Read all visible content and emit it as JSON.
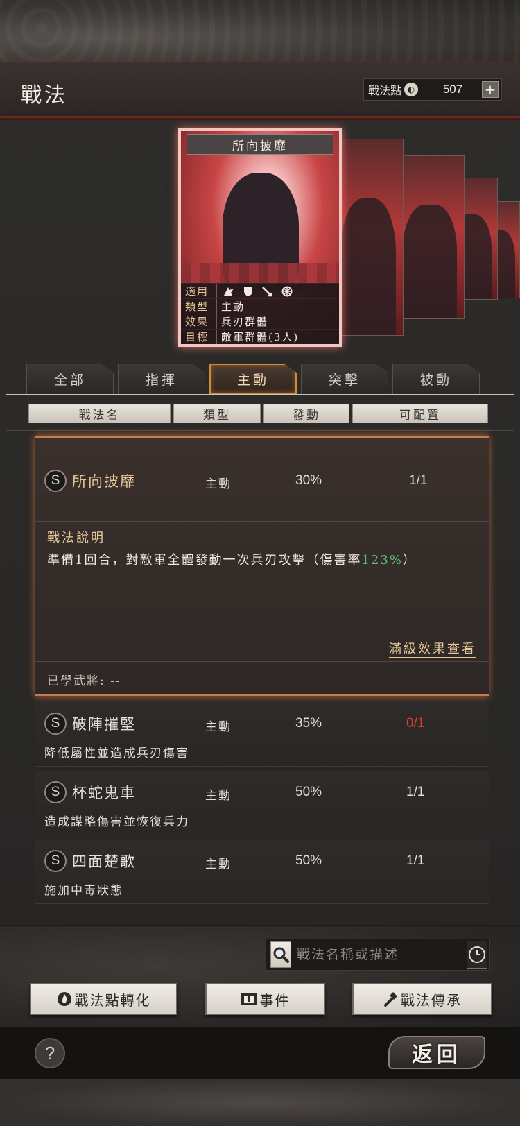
{
  "header": {
    "title": "戰法",
    "points_label": "戰法點",
    "points_icon": "coin-icon",
    "points_value": "507",
    "add_icon": "plus-icon"
  },
  "featured_card": {
    "title": "所向披靡",
    "info": [
      {
        "key": "適用",
        "value": "",
        "icons": [
          "cavalry-icon",
          "shield-icon",
          "archer-icon",
          "wheel-icon"
        ]
      },
      {
        "key": "類型",
        "value": "主動"
      },
      {
        "key": "效果",
        "value": "兵刃群體"
      },
      {
        "key": "目標",
        "value": "敵軍群體(3人)"
      }
    ]
  },
  "tabs": [
    {
      "label": "全部",
      "active": false
    },
    {
      "label": "指揮",
      "active": false
    },
    {
      "label": "主動",
      "active": true
    },
    {
      "label": "突擊",
      "active": false
    },
    {
      "label": "被動",
      "active": false
    }
  ],
  "columns": [
    "戰法名",
    "類型",
    "發動",
    "可配置"
  ],
  "expanded_item": {
    "badge": "S",
    "name": "所向披靡",
    "type": "主動",
    "rate": "30%",
    "config": "1/1",
    "desc_title": "戰法說明",
    "desc_prefix": "準備1回合，對敵軍全體發動一次兵刃攻擊（傷害率",
    "desc_highlight": "123%",
    "desc_suffix": "）",
    "full_effect_link": "滿級效果查看",
    "learned_label": "已學武將: --"
  },
  "items": [
    {
      "badge": "S",
      "name": "破陣摧堅",
      "type": "主動",
      "rate": "35%",
      "config": "0/1",
      "config_color": "#e03a2e",
      "desc": "降低屬性並造成兵刃傷害"
    },
    {
      "badge": "S",
      "name": "杯蛇鬼車",
      "type": "主動",
      "rate": "50%",
      "config": "1/1",
      "desc": "造成謀略傷害並恢復兵力"
    },
    {
      "badge": "S",
      "name": "四面楚歌",
      "type": "主動",
      "rate": "50%",
      "config": "1/1",
      "desc": "施加中毒狀態"
    }
  ],
  "search": {
    "placeholder": "戰法名稱或描述",
    "search_icon": "magnifier-icon",
    "history_icon": "clock-icon"
  },
  "buttons": {
    "convert": "戰法點轉化",
    "convert_icon": "flame-icon",
    "events": "事件",
    "events_icon": "alert-icon",
    "inherit": "戰法傳承",
    "inherit_icon": "hammer-icon"
  },
  "footer": {
    "help": "?",
    "back": "返回"
  }
}
